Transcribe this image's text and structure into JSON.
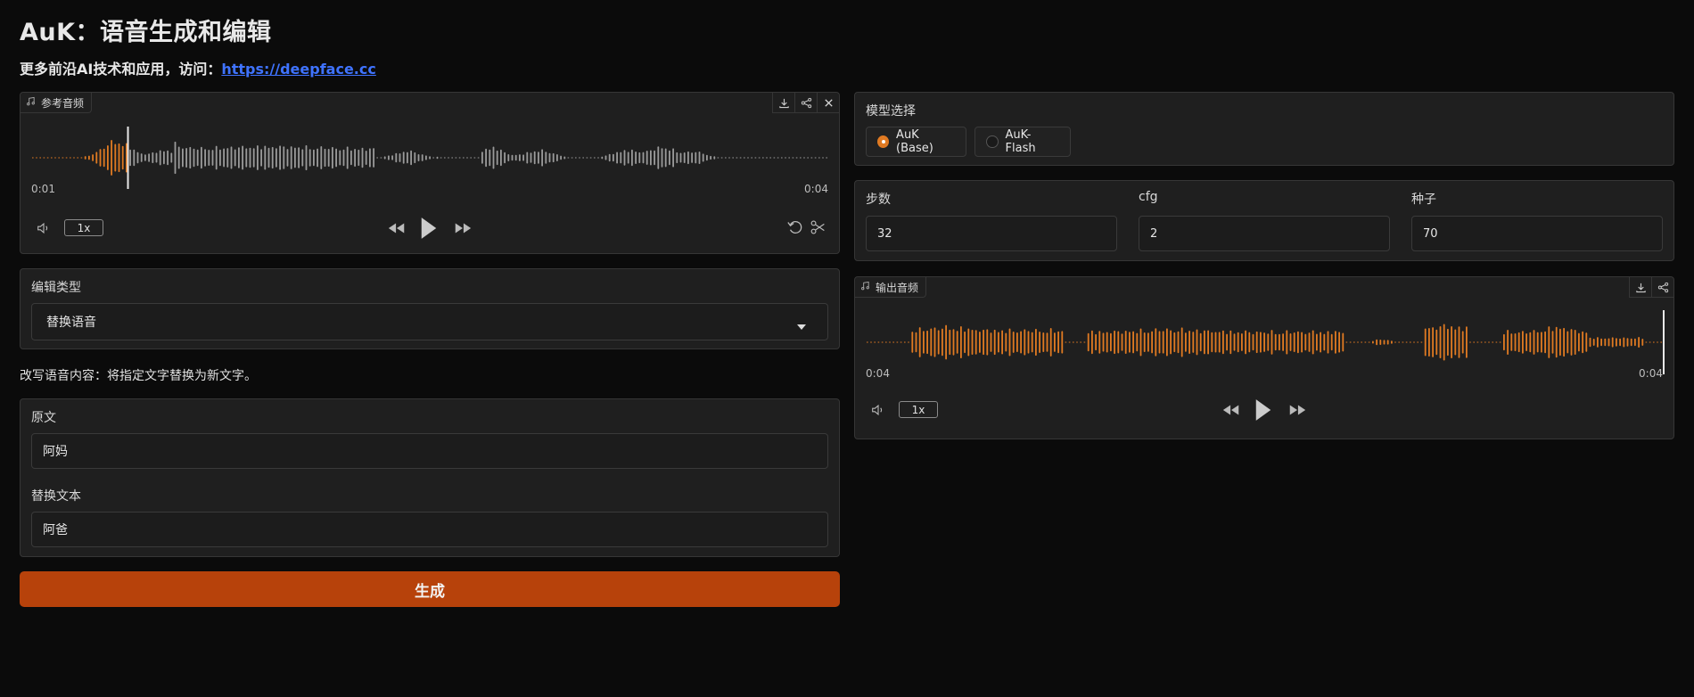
{
  "header": {
    "title": "AuK：语音生成和编辑",
    "subtitle_prefix": "更多前沿AI技术和应用，访问：",
    "subtitle_link": "https://deepface.cc"
  },
  "ref_audio": {
    "label": "参考音频",
    "time_start": "0:01",
    "time_end": "0:04",
    "rate": "1x",
    "played_fraction": 0.12
  },
  "edit_type": {
    "label": "编辑类型",
    "selected": "替换语音"
  },
  "description": "改写语音内容：将指定文字替换为新文字。",
  "text_panel": {
    "original_label": "原文",
    "original_value": "阿妈",
    "replace_label": "替换文本",
    "replace_value": "阿爸"
  },
  "generate_label": "生成",
  "model": {
    "label": "模型选择",
    "options": [
      "AuK (Base)",
      "AuK-Flash"
    ],
    "selected": "AuK (Base)"
  },
  "params": {
    "steps_label": "步数",
    "steps_value": "32",
    "cfg_label": "cfg",
    "cfg_value": "2",
    "seed_label": "种子",
    "seed_value": "70"
  },
  "out_audio": {
    "label": "输出音频",
    "time_start": "0:04",
    "time_end": "0:04",
    "rate": "1x",
    "played_fraction": 1.0
  },
  "colors": {
    "accent": "#e07a22",
    "wave_played": "#e07a22",
    "wave_unplayed": "#9a9a9a",
    "button": "#b7420b"
  }
}
